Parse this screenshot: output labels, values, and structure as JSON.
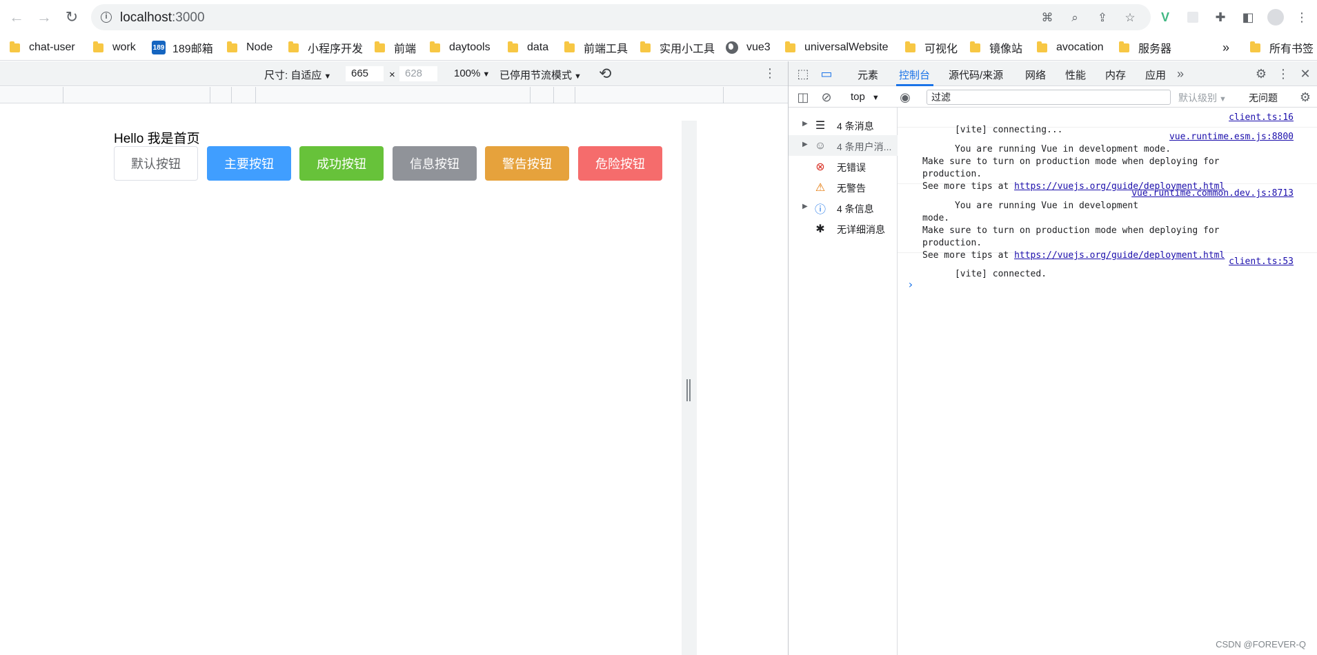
{
  "browser": {
    "url_host": "localhost",
    "url_port": ":3000"
  },
  "bookmarks": [
    {
      "label": "chat-user",
      "icon": "folder-icon"
    },
    {
      "label": "work",
      "icon": "folder-icon"
    },
    {
      "label": "189邮箱",
      "icon": "189-icon"
    },
    {
      "label": "Node",
      "icon": "folder-icon"
    },
    {
      "label": "小程序开发",
      "icon": "folder-icon"
    },
    {
      "label": "前端",
      "icon": "folder-icon"
    },
    {
      "label": "daytools",
      "icon": "folder-icon"
    },
    {
      "label": "data",
      "icon": "folder-icon"
    },
    {
      "label": "前端工具",
      "icon": "folder-icon"
    },
    {
      "label": "实用小工具",
      "icon": "folder-icon"
    },
    {
      "label": "vue3",
      "icon": "globe-icon"
    },
    {
      "label": "universalWebsite",
      "icon": "folder-icon"
    },
    {
      "label": "可视化",
      "icon": "folder-icon"
    },
    {
      "label": "镜像站",
      "icon": "folder-icon"
    },
    {
      "label": "avocation",
      "icon": "folder-icon"
    },
    {
      "label": "服务器",
      "icon": "folder-icon"
    }
  ],
  "bookmarks_overflow": "»",
  "bookmarks_all": "所有书签",
  "device_toolbar": {
    "dimensions_label": "尺寸: 自适应",
    "width": "665",
    "times": "×",
    "height": "628",
    "zoom": "100%",
    "throttle": "已停用节流模式"
  },
  "page": {
    "hello": "Hello 我是首页",
    "buttons": [
      {
        "label": "默认按钮",
        "color": "#ffffff"
      },
      {
        "label": "主要按钮",
        "color": "#409eff"
      },
      {
        "label": "成功按钮",
        "color": "#67c23a"
      },
      {
        "label": "信息按钮",
        "color": "#909399"
      },
      {
        "label": "警告按钮",
        "color": "#e6a23c"
      },
      {
        "label": "危险按钮",
        "color": "#f56c6c"
      }
    ]
  },
  "devtools": {
    "tabs": [
      "元素",
      "控制台",
      "源代码/来源",
      "网络",
      "性能",
      "内存",
      "应用"
    ],
    "active_tab": "控制台",
    "context": "top",
    "filter_placeholder": "过滤",
    "level": "默认级别",
    "issues": "无问题",
    "sidebar": [
      {
        "label": "4 条消息",
        "icon": "list-icon"
      },
      {
        "label": "4 条用户消...",
        "icon": "user-icon"
      },
      {
        "label": "无错误",
        "icon": "error-icon"
      },
      {
        "label": "无警告",
        "icon": "warning-icon"
      },
      {
        "label": "4 条信息",
        "icon": "info-icon"
      },
      {
        "label": "无详细消息",
        "icon": "bug-icon"
      }
    ],
    "messages": [
      {
        "text": "[vite] connecting...",
        "source": "client.ts:16"
      },
      {
        "text": "You are running Vue in development mode.\nMake sure to turn on production mode when deploying for\nproduction.\nSee more tips at ",
        "link": "https://vuejs.org/guide/deployment.html",
        "source": "vue.runtime.esm.js:8800"
      },
      {
        "text": "You are running Vue in development\nmode.\nMake sure to turn on production mode when deploying for\nproduction.\nSee more tips at ",
        "link": "https://vuejs.org/guide/deployment.html",
        "source": "vue.runtime.common.dev.js:8713"
      },
      {
        "text": "[vite] connected.",
        "source": "client.ts:53"
      }
    ],
    "prompt": "›"
  },
  "watermark": "CSDN @FOREVER-Q"
}
